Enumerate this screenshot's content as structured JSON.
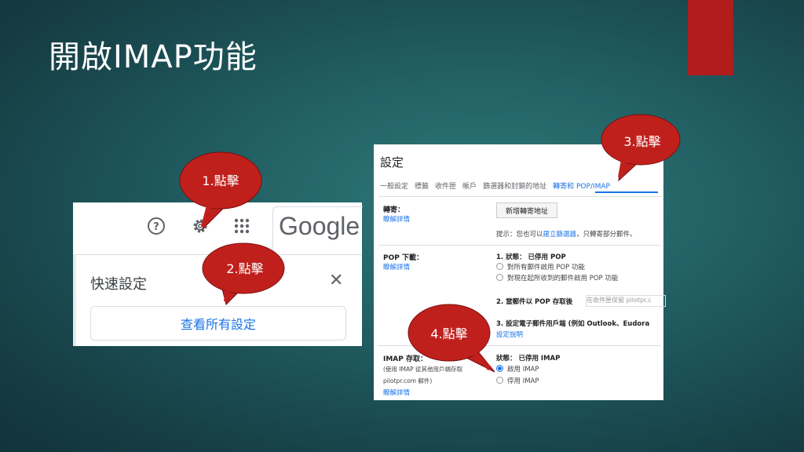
{
  "slide": {
    "title": "開啟IMAP功能"
  },
  "colors": {
    "accent_bar": "#b11c1c",
    "bubble": "#c0201c",
    "link": "#1a73e8"
  },
  "quick": {
    "help_icon": "?",
    "gear_icon": "⚙",
    "apps_icon": "⋮⋮⋮",
    "google": "Google",
    "title": "快速設定",
    "close": "✕",
    "view_all": "查看所有設定"
  },
  "settings": {
    "title": "設定",
    "tabs": [
      "一般設定",
      "標籤",
      "收件匣",
      "帳戶",
      "篩選器和封鎖的地址",
      "轉寄和 POP/IMAP"
    ],
    "forward": {
      "label": "轉寄：",
      "learn": "瞭解詳情",
      "button": "新增轉寄地址",
      "hint": "提示：您也可以",
      "hint_link": "建立篩選器",
      "hint_rest": "，只轉寄部分郵件。"
    },
    "pop": {
      "label": "POP 下載：",
      "learn": "瞭解詳情",
      "status": "1. 狀態： 已停用 POP",
      "opt1": "對所有郵件啟用 POP 功能",
      "opt2": "對現在起所收到的郵件啟用 POP 功能",
      "step2": "2. 當郵件以 POP 存取後",
      "step2_select": "在收件匣保留 pilotpr.c",
      "step3": "3. 設定電子郵件用戶端 (例如 Outlook、Eudora",
      "step3_link": "設定說明"
    },
    "imap": {
      "label": "IMAP 存取：",
      "desc1": "(使用 IMAP 從其他用戶端存取",
      "desc2": "pilotpr.com 郵件)",
      "learn": "瞭解詳情",
      "status": "狀態： 已停用 IMAP",
      "enable": "啟用 IMAP",
      "disable": "停用 IMAP"
    }
  },
  "callouts": [
    "1.點擊",
    "2.點擊",
    "3.點擊",
    "4.點擊"
  ]
}
